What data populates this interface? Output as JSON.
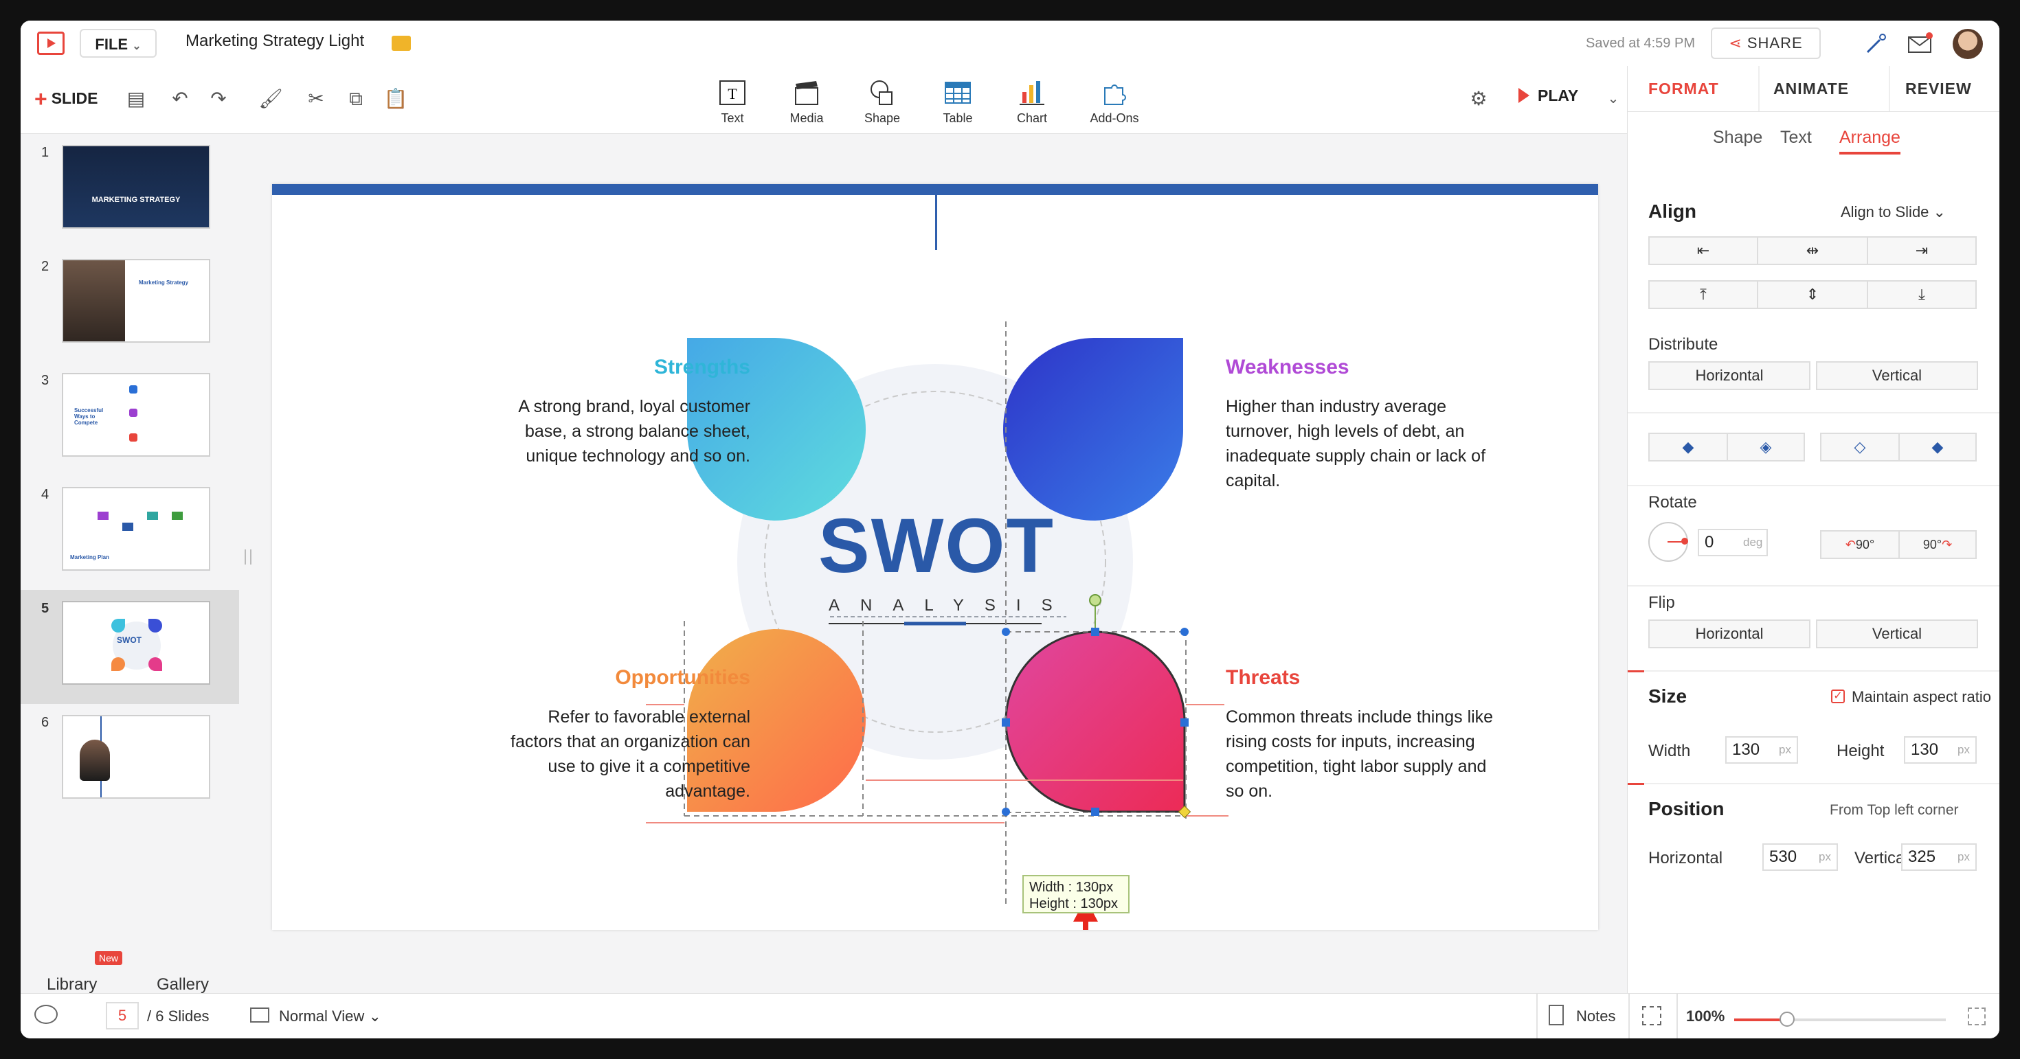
{
  "app": {
    "file_label": "FILE",
    "doc_title": "Marketing Strategy Light",
    "saved_text": "Saved at 4:59 PM",
    "share_label": "SHARE",
    "accent": "#e8453c"
  },
  "toolbar": {
    "slide_label": "SLIDE",
    "insert": [
      {
        "label": "Text",
        "icon": "text-box-icon"
      },
      {
        "label": "Media",
        "icon": "media-clapper-icon"
      },
      {
        "label": "Shape",
        "icon": "shape-icon"
      },
      {
        "label": "Table",
        "icon": "table-icon"
      },
      {
        "label": "Chart",
        "icon": "bar-chart-icon"
      },
      {
        "label": "Add-Ons",
        "icon": "puzzle-icon"
      }
    ],
    "play_label": "PLAY"
  },
  "slides_panel": {
    "items": [
      {
        "num": "1",
        "caption": "MARKETING STRATEGY"
      },
      {
        "num": "2",
        "caption": "Marketing Strategy"
      },
      {
        "num": "3",
        "caption": "Successful Ways to Compete"
      },
      {
        "num": "4",
        "caption": "Marketing Plan"
      },
      {
        "num": "5",
        "caption": "SWOT"
      },
      {
        "num": "6",
        "caption": ""
      }
    ],
    "library_label": "Library",
    "new_badge": "New",
    "gallery_label": "Gallery"
  },
  "slide": {
    "title": "SWOT",
    "subtitle": "ANALYSIS",
    "strengths": {
      "heading": "Strengths",
      "lines": [
        "A strong  brand, loyal  customer",
        "base, a strong  balance  sheet,",
        "unique  technology  and so on."
      ],
      "color": "#2fb5d8"
    },
    "weaknesses": {
      "heading": "Weaknesses",
      "lines": [
        "Higher  than industry  average",
        "turnover, high levels of debt, an",
        "inadequate  supply  chain or lack of",
        "capital."
      ],
      "color": "#b04ad6"
    },
    "opportunities": {
      "heading": "Opportunities",
      "lines": [
        "Refer  to favorable  external",
        "factors  that an organization  can",
        "use to give it a competitive",
        "advantage."
      ],
      "color": "#f28a3c"
    },
    "threats": {
      "heading": "Threats",
      "lines": [
        "Common  threats  include  things  like",
        "rising  costs  for inputs,  increasing",
        "competition,  tight  labor  supply  and",
        "so on."
      ],
      "color": "#e8453c"
    },
    "tooltip_width": "Width : 130px",
    "tooltip_height": "Height : 130px"
  },
  "format_panel": {
    "tabs": [
      "FORMAT",
      "ANIMATE",
      "REVIEW"
    ],
    "subtabs": [
      "Shape",
      "Text",
      "Arrange"
    ],
    "align_title": "Align",
    "align_to": "Align to Slide",
    "distribute_title": "Distribute",
    "distribute_horizontal": "Horizontal",
    "distribute_vertical": "Vertical",
    "rotate_title": "Rotate",
    "rotate_value": "0",
    "rotate_unit": "deg",
    "rotate_ccw": "90°",
    "rotate_cw": "90°",
    "flip_title": "Flip",
    "flip_horizontal": "Horizontal",
    "flip_vertical": "Vertical",
    "size_title": "Size",
    "maintain_aspect": "Maintain aspect ratio",
    "width_label": "Width",
    "width_value": "130",
    "height_label": "Height",
    "height_value": "130",
    "unit_px": "px",
    "position_title": "Position",
    "position_from": "From Top left corner",
    "pos_h_label": "Horizontal",
    "pos_h_value": "530",
    "pos_v_label": "Vertical",
    "pos_v_value": "325"
  },
  "statusbar": {
    "current_page": "5",
    "total_pages": "/ 6 Slides",
    "view_mode": "Normal View",
    "notes_label": "Notes",
    "zoom": "100%",
    "zoom_fraction": 0.25
  }
}
